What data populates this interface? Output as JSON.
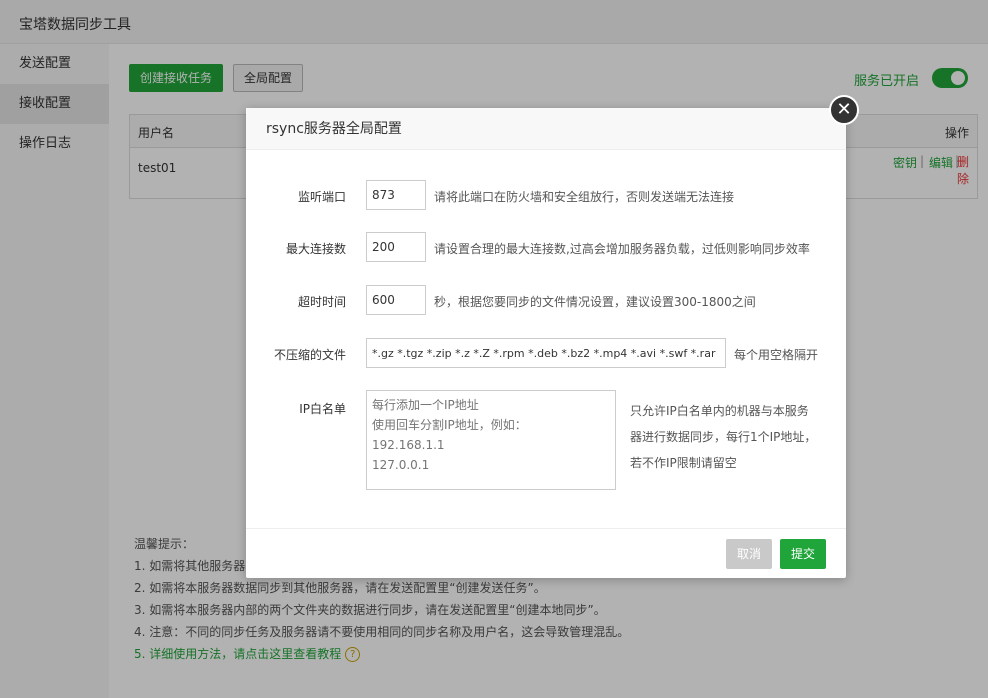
{
  "app": {
    "title": "宝塔数据同步工具"
  },
  "sidebar": {
    "items": [
      {
        "label": "发送配置"
      },
      {
        "label": "接收配置"
      },
      {
        "label": "操作日志"
      }
    ]
  },
  "toolbar": {
    "create_label": "创建接收任务",
    "global_label": "全局配置",
    "service_status": "服务已开启",
    "service_on": true
  },
  "table": {
    "headers": {
      "username": "用户名",
      "actions": "操作"
    },
    "rows": [
      {
        "username": "test01",
        "key": "密钥",
        "edit": "编辑",
        "delete": "删除",
        "sep": "|"
      }
    ]
  },
  "tips": {
    "title": "温馨提示：",
    "lines": [
      "1. 如需将其他服务器",
      "2. 如需将本服务器数据同步到其他服务器，请在发送配置里“创建发送任务”。",
      "3. 如需将本服务器内部的两个文件夹的数据进行同步，请在发送配置里“创建本地同步”。",
      "4. 注意：不同的同步任务及服务器请不要使用相同的同步名称及用户名，这会导致管理混乱。",
      "5. 详细使用方法，请点击这里查看教程"
    ],
    "help_glyph": "?"
  },
  "modal": {
    "title": "rsync服务器全局配置",
    "close_glyph": "✕",
    "fields": {
      "port": {
        "label": "监听端口",
        "value": "873",
        "hint": "请将此端口在防火墙和安全组放行，否则发送端无法连接"
      },
      "max_conn": {
        "label": "最大连接数",
        "value": "200",
        "hint": "请设置合理的最大连接数,过高会增加服务器负载，过低则影响同步效率"
      },
      "timeout": {
        "label": "超时时间",
        "value": "600",
        "hint": "秒，根据您要同步的文件情况设置，建议设置300-1800之间"
      },
      "no_compress": {
        "label": "不压缩的文件",
        "value": "*.gz *.tgz *.zip *.z *.Z *.rpm *.deb *.bz2 *.mp4 *.avi *.swf *.rar",
        "hint": "每个用空格隔开"
      },
      "whitelist": {
        "label": "IP白名单",
        "placeholder": "每行添加一个IP地址\n使用回车分割IP地址，例如：\n192.168.1.1\n127.0.0.1",
        "hint_lines": [
          "只允许IP白名单内的机器与本服务",
          "器进行数据同步，每行1个IP地址，",
          "若不作IP限制请留空"
        ]
      }
    },
    "cancel_label": "取消",
    "submit_label": "提交"
  },
  "colors": {
    "accent": "#20a53a",
    "danger": "#e33333",
    "overlay": "rgba(0,0,0,0.3)"
  }
}
